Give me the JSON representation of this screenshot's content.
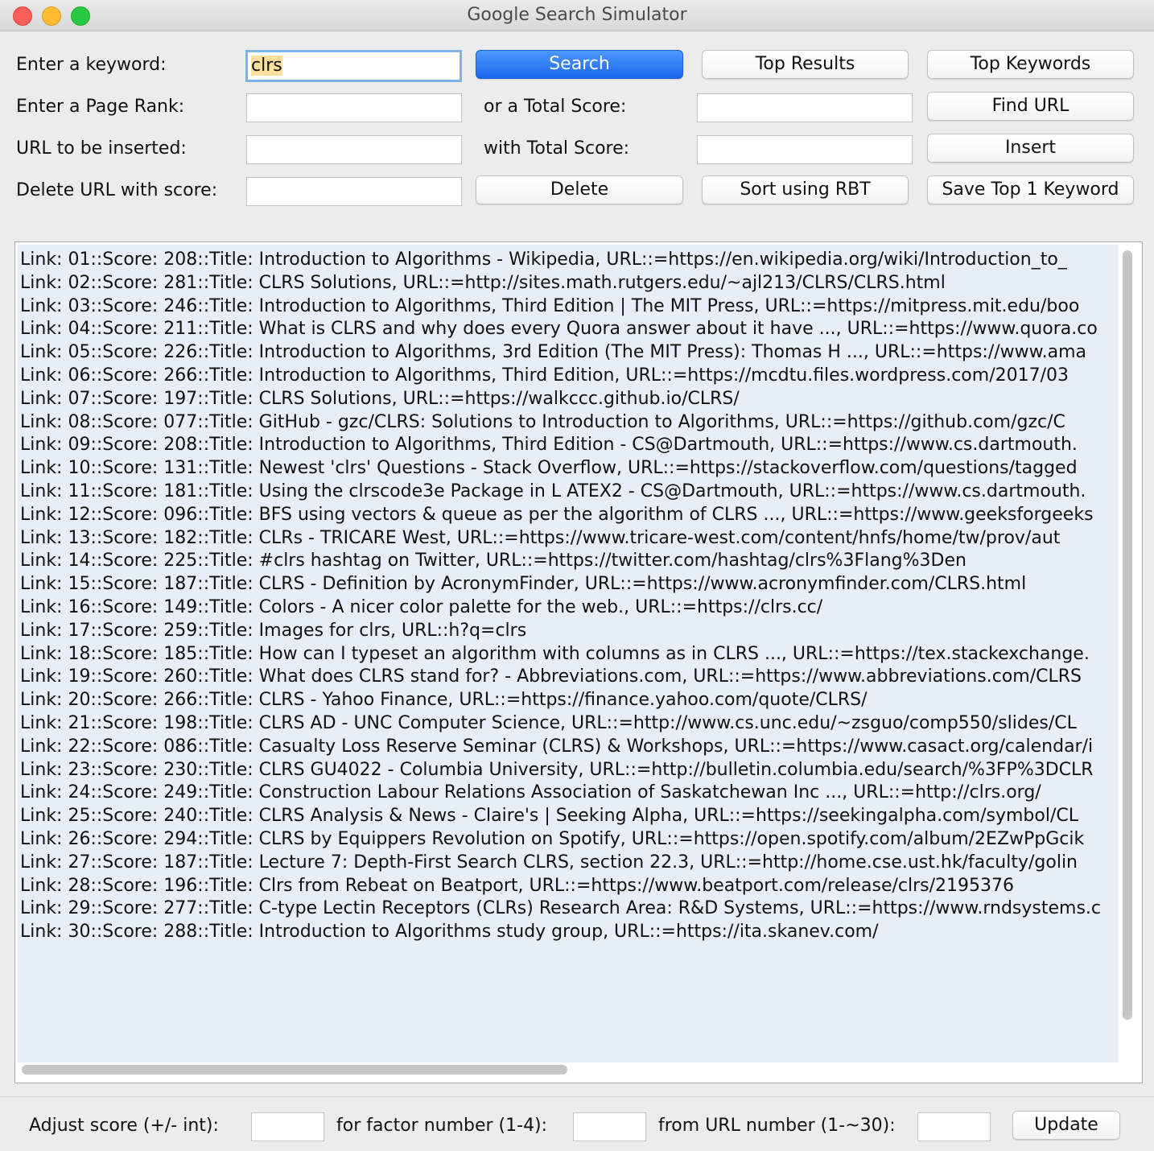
{
  "window": {
    "title": "Google Search Simulator"
  },
  "form": {
    "keyword_label": "Enter a keyword:",
    "keyword_value": "clrs",
    "pagerank_label": "Enter a Page Rank:",
    "pagerank_value": "",
    "total_score_label": "or a Total Score:",
    "total_score_value": "",
    "url_insert_label": "URL to be inserted:",
    "url_insert_value": "",
    "with_total_score_label": "with Total Score:",
    "with_total_score_value": "",
    "delete_label": "Delete URL with score:",
    "delete_value": ""
  },
  "buttons": {
    "search": "Search",
    "top_results": "Top Results",
    "top_keywords": "Top Keywords",
    "find_url": "Find URL",
    "insert": "Insert",
    "delete": "Delete",
    "sort_rbt": "Sort using RBT",
    "save_top_keyword": "Save Top 1 Keyword",
    "update": "Update"
  },
  "results": [
    "Link: 01::Score: 208::Title: Introduction to Algorithms - Wikipedia, URL::=https://en.wikipedia.org/wiki/Introduction_to_",
    "Link: 02::Score: 281::Title: CLRS Solutions, URL::=http://sites.math.rutgers.edu/~ajl213/CLRS/CLRS.html",
    "Link: 03::Score: 246::Title: Introduction to Algorithms, Third Edition | The MIT Press, URL::=https://mitpress.mit.edu/boo",
    "Link: 04::Score: 211::Title: What is CLRS and why does every Quora answer about it have ..., URL::=https://www.quora.co",
    "Link: 05::Score: 226::Title: Introduction to Algorithms, 3rd Edition (The MIT Press): Thomas H ..., URL::=https://www.ama",
    "Link: 06::Score: 266::Title: Introduction to Algorithms, Third Edition, URL::=https://mcdtu.files.wordpress.com/2017/03",
    "Link: 07::Score: 197::Title: CLRS Solutions, URL::=https://walkccc.github.io/CLRS/",
    "Link: 08::Score: 077::Title: GitHub - gzc/CLRS: Solutions to Introduction to Algorithms, URL::=https://github.com/gzc/C",
    "Link: 09::Score: 208::Title: Introduction to Algorithms, Third Edition - CS@Dartmouth, URL::=https://www.cs.dartmouth.",
    "Link: 10::Score: 131::Title: Newest 'clrs' Questions - Stack Overflow, URL::=https://stackoverflow.com/questions/tagged",
    "Link: 11::Score: 181::Title: Using the clrscode3e Package in L ATEX2 - CS@Dartmouth, URL::=https://www.cs.dartmouth.",
    "Link: 12::Score: 096::Title: BFS using vectors & queue as per the algorithm of CLRS ..., URL::=https://www.geeksforgeeks",
    "Link: 13::Score: 182::Title: CLRs - TRICARE West, URL::=https://www.tricare-west.com/content/hnfs/home/tw/prov/aut",
    "Link: 14::Score: 225::Title: #clrs hashtag on Twitter, URL::=https://twitter.com/hashtag/clrs%3Flang%3Den",
    "Link: 15::Score: 187::Title: CLRS - Definition by AcronymFinder, URL::=https://www.acronymfinder.com/CLRS.html",
    "Link: 16::Score: 149::Title: Colors - A nicer color palette for the web., URL::=https://clrs.cc/",
    "Link: 17::Score: 259::Title: Images for clrs, URL::h?q=clrs",
    "Link: 18::Score: 185::Title: How can I typeset an algorithm with columns as in CLRS ..., URL::=https://tex.stackexchange.",
    "Link: 19::Score: 260::Title: What does CLRS stand for? - Abbreviations.com, URL::=https://www.abbreviations.com/CLRS",
    "Link: 20::Score: 266::Title: CLRS - Yahoo Finance, URL::=https://finance.yahoo.com/quote/CLRS/",
    "Link: 21::Score: 198::Title: CLRS AD - UNC Computer Science, URL::=http://www.cs.unc.edu/~zsguo/comp550/slides/CL",
    "Link: 22::Score: 086::Title: Casualty Loss Reserve Seminar (CLRS) & Workshops, URL::=https://www.casact.org/calendar/i",
    "Link: 23::Score: 230::Title: CLRS GU4022 - Columbia University, URL::=http://bulletin.columbia.edu/search/%3FP%3DCLR",
    "Link: 24::Score: 249::Title: Construction Labour Relations Association of Saskatchewan Inc ..., URL::=http://clrs.org/",
    "Link: 25::Score: 240::Title: CLRS Analysis & News - Claire's | Seeking Alpha, URL::=https://seekingalpha.com/symbol/CL",
    "Link: 26::Score: 294::Title: CLRS by Equippers Revolution on Spotify, URL::=https://open.spotify.com/album/2EZwPpGcik",
    "Link: 27::Score: 187::Title: Lecture 7: Depth-First Search CLRS, section 22.3, URL::=http://home.cse.ust.hk/faculty/golin",
    "Link: 28::Score: 196::Title: Clrs from Rebeat on Beatport, URL::=https://www.beatport.com/release/clrs/2195376",
    "Link: 29::Score: 277::Title: C-type Lectin Receptors (CLRs) Research Area: R&D Systems, URL::=https://www.rndsystems.c",
    "Link: 30::Score: 288::Title: Introduction to Algorithms study group, URL::=https://ita.skanev.com/"
  ],
  "adjust": {
    "score_label": "Adjust score (+/- int):",
    "score_value": "",
    "factor_label": "for factor number (1-4):",
    "factor_value": "",
    "url_label": "from URL number (1-~30):",
    "url_value": ""
  }
}
